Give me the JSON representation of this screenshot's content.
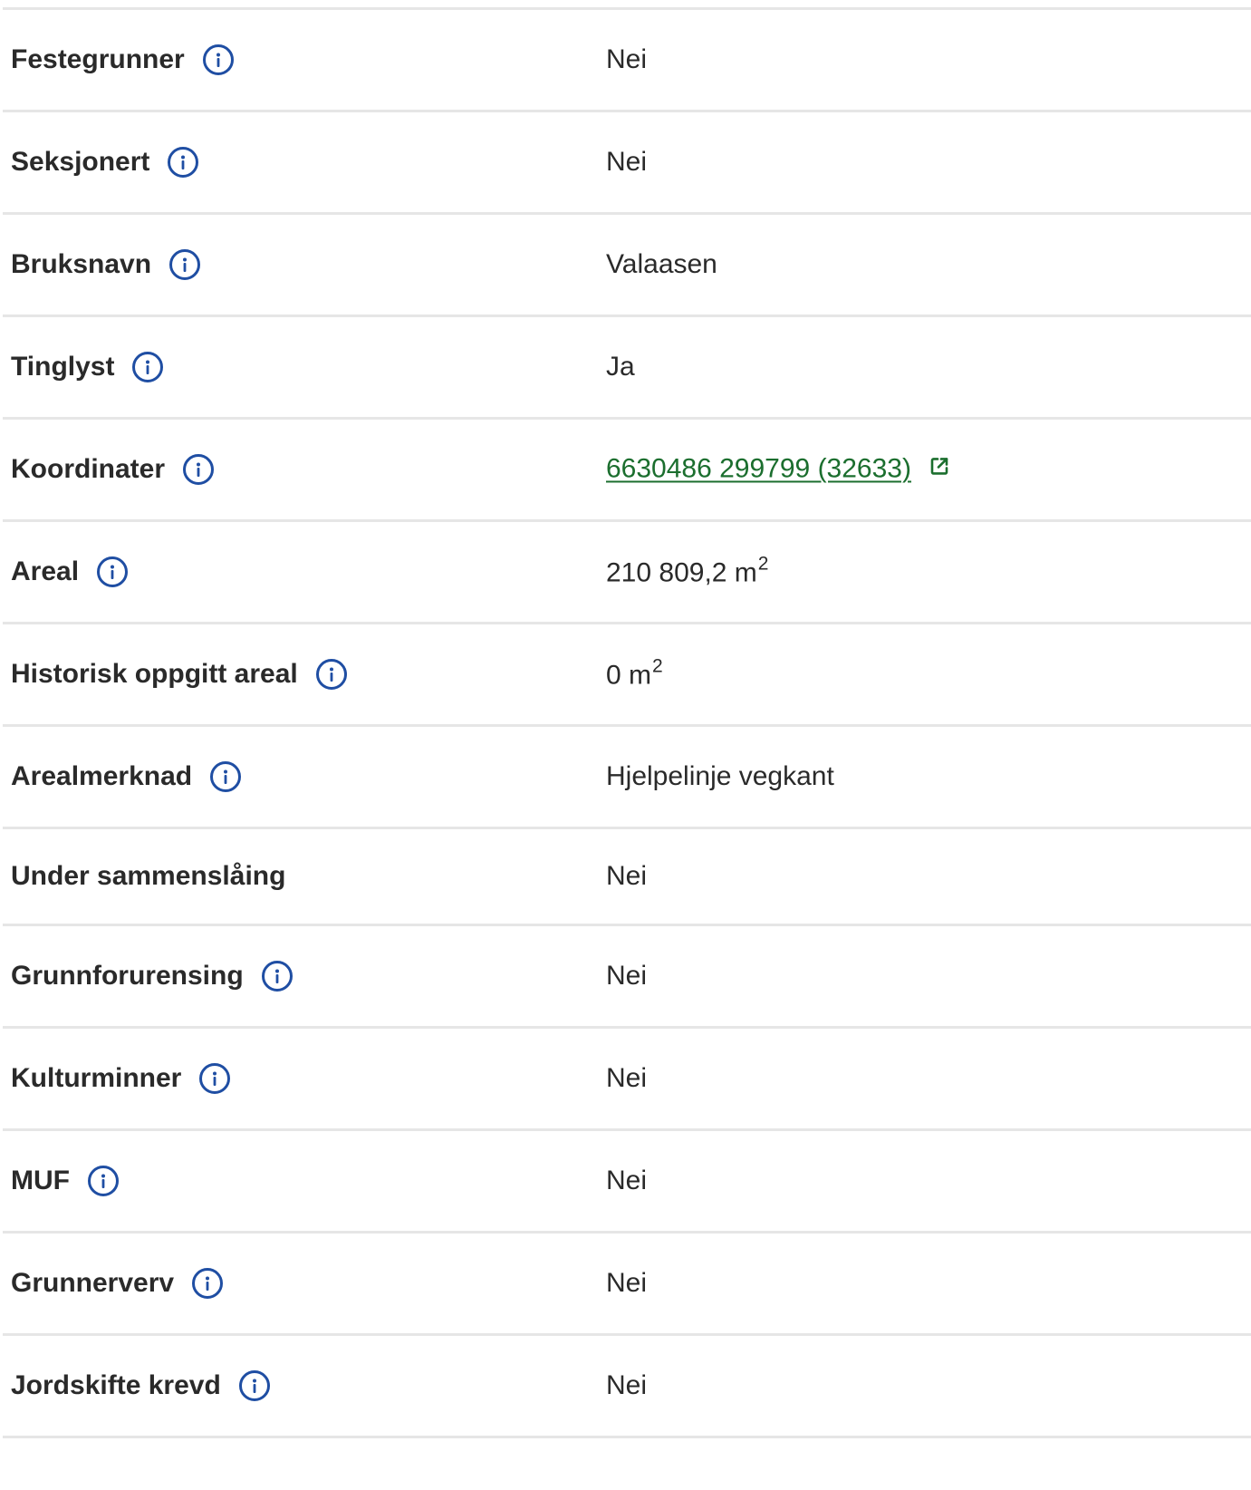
{
  "rows": [
    {
      "label": "Festegrunner",
      "value": "Nei"
    },
    {
      "label": "Seksjonert",
      "value": "Nei"
    },
    {
      "label": "Bruksnavn",
      "value": "Valaasen"
    },
    {
      "label": "Tinglyst",
      "value": "Ja"
    },
    {
      "label": "Koordinater",
      "value": "6630486 299799 (32633)"
    },
    {
      "label": "Areal",
      "value": "210 809,2 m",
      "unit_exp": "2"
    },
    {
      "label": "Historisk oppgitt areal",
      "value": "0 m",
      "unit_exp": "2"
    },
    {
      "label": "Arealmerknad",
      "value": "Hjelpelinje vegkant"
    },
    {
      "label": "Under sammenslåing",
      "value": "Nei"
    },
    {
      "label": "Grunnforurensing",
      "value": "Nei"
    },
    {
      "label": "Kulturminner",
      "value": "Nei"
    },
    {
      "label": "MUF",
      "value": "Nei"
    },
    {
      "label": "Grunnerverv",
      "value": "Nei"
    },
    {
      "label": "Jordskifte krevd",
      "value": "Nei"
    }
  ],
  "icons": {
    "info": "info-icon",
    "external_link": "external-link-icon"
  },
  "colors": {
    "info_icon": "#1f4ea3",
    "link": "#1b6e2e",
    "divider": "#e6e6e6"
  }
}
